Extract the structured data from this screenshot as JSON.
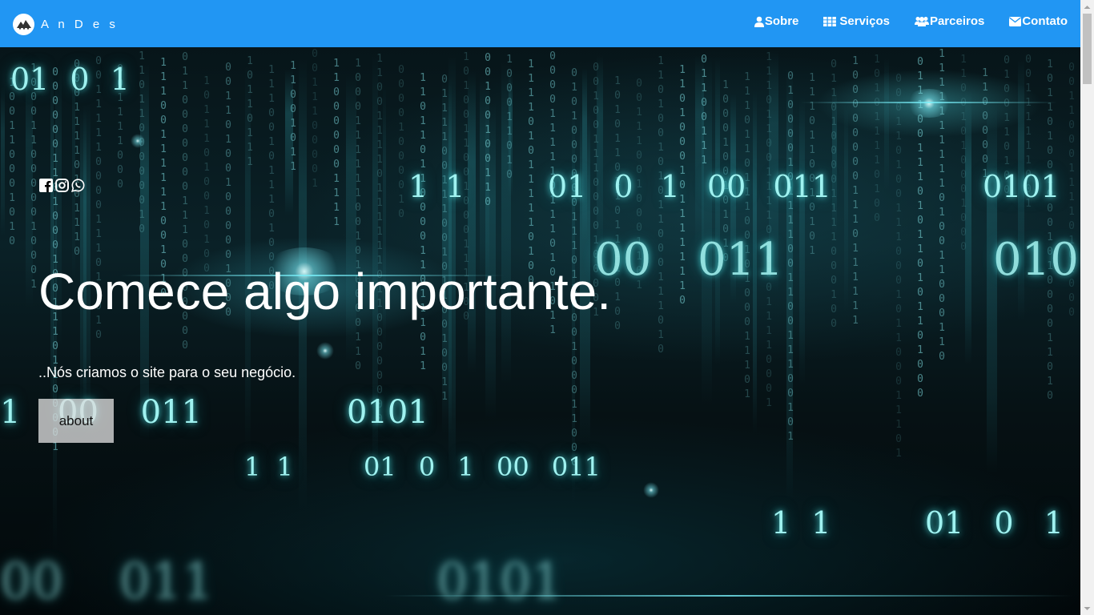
{
  "brand": {
    "name": "A n D e s",
    "logo_icon": "andes-logo-icon"
  },
  "nav": {
    "items": [
      {
        "label": "Sobre",
        "icon": "user-icon"
      },
      {
        "label": "Serviços",
        "icon": "grid-icon"
      },
      {
        "label": "Parceiros",
        "icon": "users-icon"
      },
      {
        "label": "Contato",
        "icon": "envelope-icon"
      }
    ]
  },
  "social": {
    "icons": [
      "facebook-icon",
      "instagram-icon",
      "whatsapp-icon"
    ]
  },
  "hero": {
    "title": "Comece algo importante.",
    "subtitle": "..Nós criamos o site para o seu negócio.",
    "button_label": "about",
    "background_digits": [
      "01 0 1",
      "1 1",
      "01 0 1 00 011",
      "0101",
      "00 011",
      "010",
      "1",
      "00 011",
      "0101",
      "1 1",
      "01 0 1 00 011",
      "1 1",
      "01 0 1",
      "00 011",
      "0101"
    ]
  },
  "colors": {
    "navbar": "#2196f3",
    "text": "#ffffff",
    "button_bg": "#dcdcdc",
    "digit_glow": "#9ff2f0"
  }
}
